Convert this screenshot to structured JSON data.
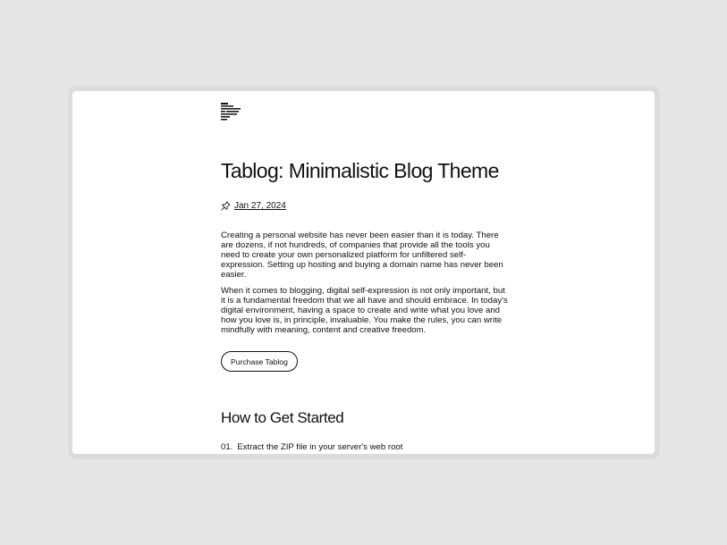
{
  "post": {
    "title": "Tablog: Minimalistic Blog Theme",
    "date": "Jan 27, 2024",
    "paragraphs": [
      "Creating a personal website has never been easier than it is today. There are dozens, if not hundreds, of companies that provide all the tools you need to create your own personalized platform for unfiltered self-expression. Setting up hosting and buying a domain name has never been easier.",
      "When it comes to blogging, digital self-expression is not only important, but it is a fundamental freedom that we all have and should embrace. In today's digital environment, having a space to create and write what you love and how you love is, in principle, invaluable. You make the rules, you can write mindfully with meaning, content and creative freedom."
    ],
    "cta_label": "Purchase Tablog"
  },
  "section": {
    "heading": "How to Get Started",
    "steps": [
      {
        "num": "01.",
        "text": "Extract the ZIP file in your server's web root"
      }
    ]
  },
  "icons": {
    "logo": "tablog-logo-icon",
    "date": "pin-icon"
  },
  "colors": {
    "background": "#e6e6e6",
    "page": "#ffffff",
    "text": "#111111"
  }
}
